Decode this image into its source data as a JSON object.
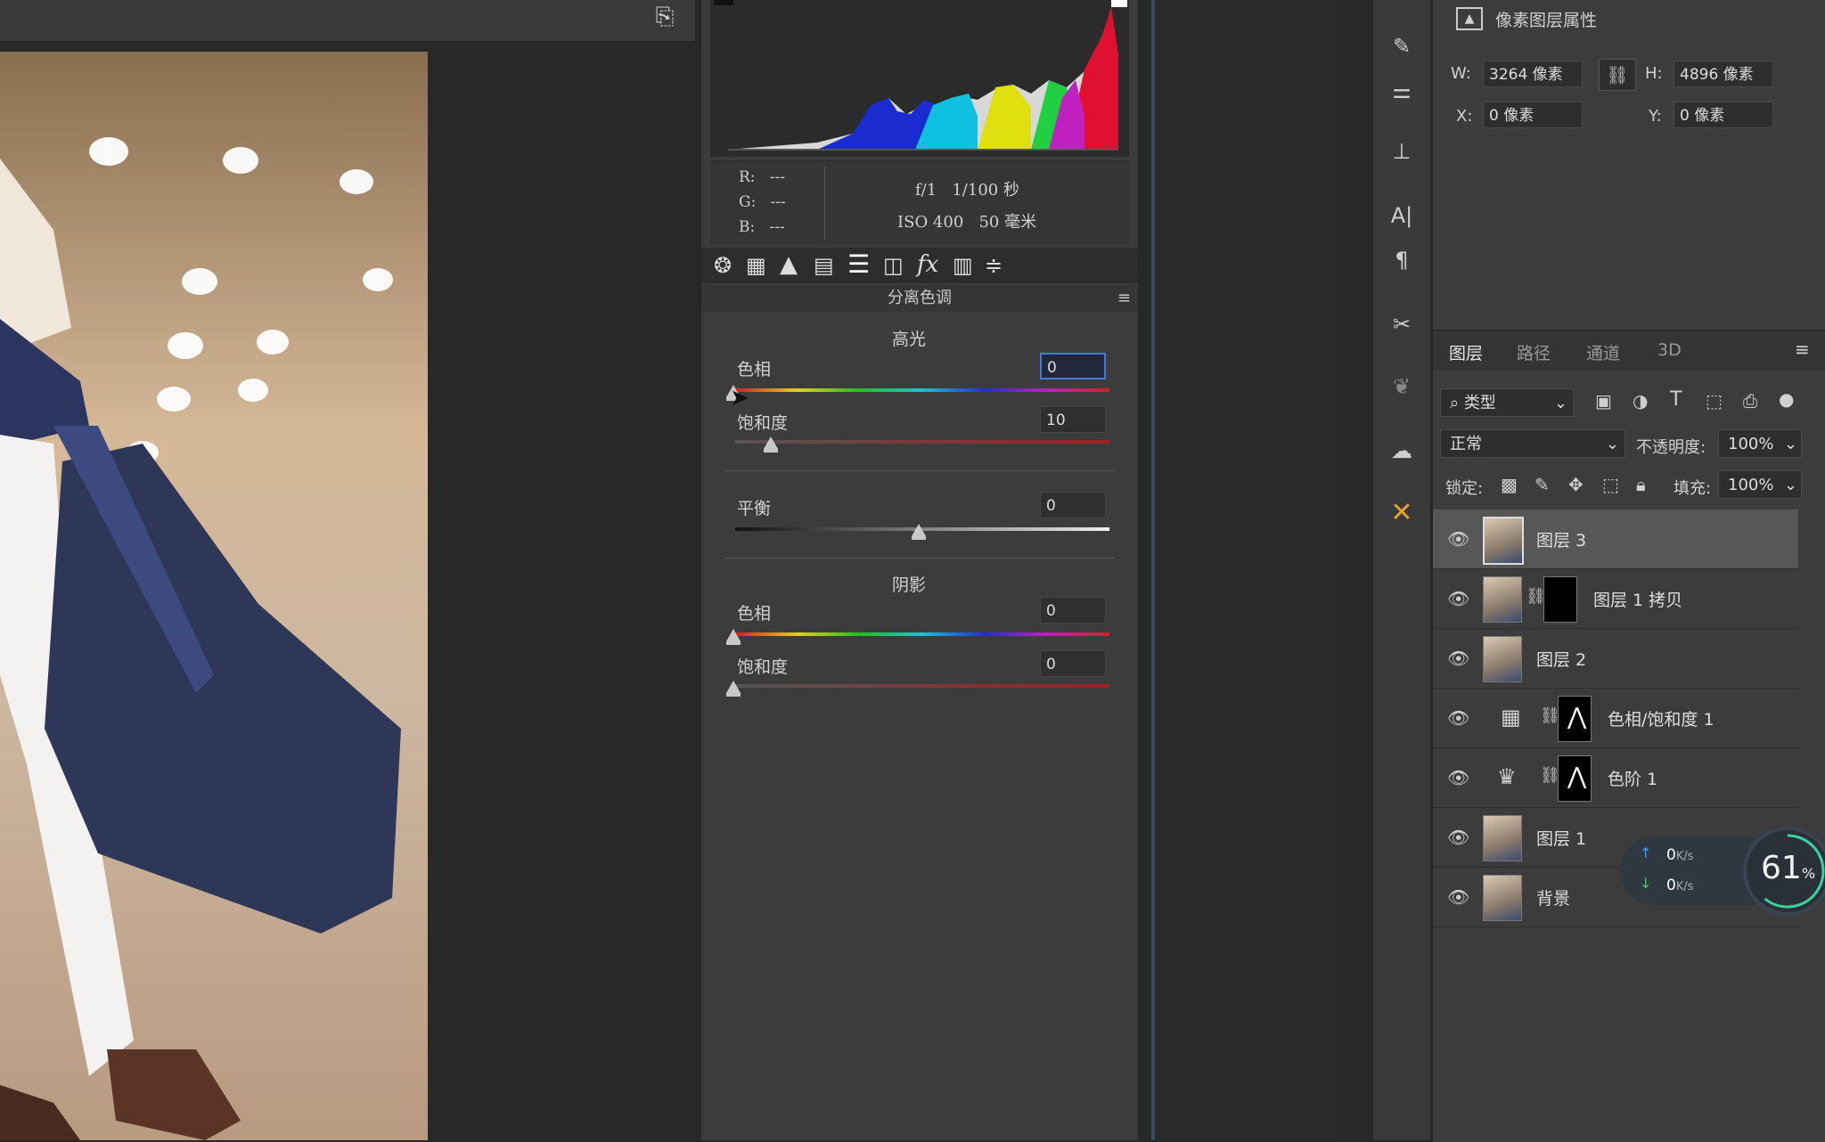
{
  "acr": {
    "info": {
      "r_label": "R:",
      "r_val": "---",
      "g_label": "G:",
      "g_val": "---",
      "b_label": "B:",
      "b_val": "---",
      "exposure": "f/1   1/100 秒",
      "iso_focal": "ISO 400   50 毫米"
    },
    "section_title": "分离色调",
    "highlights": {
      "title": "高光",
      "hue_label": "色相",
      "hue_value": "0",
      "sat_label": "饱和度",
      "sat_value": "10"
    },
    "balance": {
      "label": "平衡",
      "value": "0"
    },
    "shadows": {
      "title": "阴影",
      "hue_label": "色相",
      "hue_value": "0",
      "sat_label": "饱和度",
      "sat_value": "0"
    },
    "tab_icons": [
      "aperture-icon",
      "grid-icon",
      "mountain-icon",
      "split-icon",
      "lines-icon",
      "lens-icon",
      "fx-icon",
      "film-icon",
      "sliders-icon"
    ]
  },
  "props": {
    "title": "像素图层属性",
    "w_label": "W:",
    "w_value": "3264 像素",
    "h_label": "H:",
    "h_value": "4896 像素",
    "x_label": "X:",
    "x_value": "0 像素",
    "y_label": "Y:",
    "y_value": "0 像素"
  },
  "layers_panel": {
    "tabs": [
      "图层",
      "路径",
      "通道",
      "3D"
    ],
    "filter": "类型",
    "blend_mode": "正常",
    "opacity_label": "不透明度:",
    "opacity_value": "100%",
    "lock_label": "锁定:",
    "fill_label": "填充:",
    "fill_value": "100%",
    "layers": [
      {
        "name": "图层 3"
      },
      {
        "name": "图层 1 拷贝"
      },
      {
        "name": "图层 2"
      },
      {
        "name": "色相/饱和度 1"
      },
      {
        "name": "色阶 1"
      },
      {
        "name": "图层 1"
      },
      {
        "name": "背景"
      }
    ]
  },
  "net_widget": {
    "up": "0",
    "down": "0",
    "unit": "K/s",
    "percent": "61",
    "percent_sign": "%"
  },
  "colors": {
    "selected_field_border": "#3d7be0",
    "accent_orange": "#e8a030"
  }
}
